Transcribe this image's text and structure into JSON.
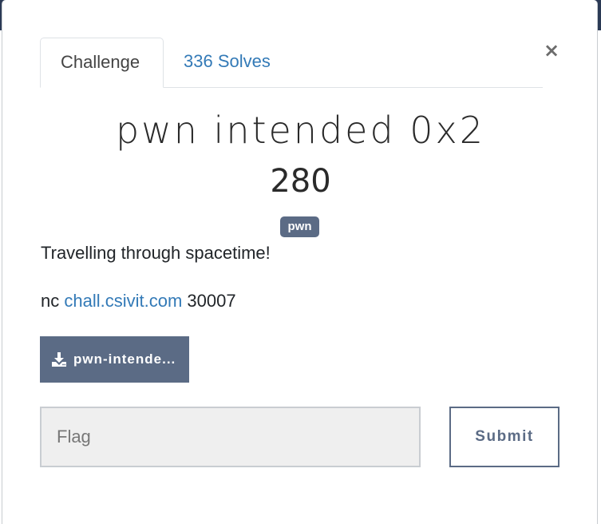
{
  "modal": {
    "close_label": "×",
    "tabs": [
      {
        "label": "Challenge",
        "active": true
      },
      {
        "label": "336 Solves",
        "active": false
      }
    ],
    "title": "pwn intended 0x2",
    "points": "280",
    "tag": "pwn",
    "description": "Travelling through spacetime!",
    "connection": {
      "prefix": "nc",
      "host": "chall.csivit.com",
      "port": "30007"
    },
    "file_button": {
      "label": "pwn-intende...",
      "icon": "download-icon"
    },
    "flag_input": {
      "placeholder": "Flag",
      "value": ""
    },
    "submit_label": "Submit"
  },
  "colors": {
    "accent": "#5b6b85",
    "link": "#337ab7",
    "top_strip": "#2b3a55"
  }
}
